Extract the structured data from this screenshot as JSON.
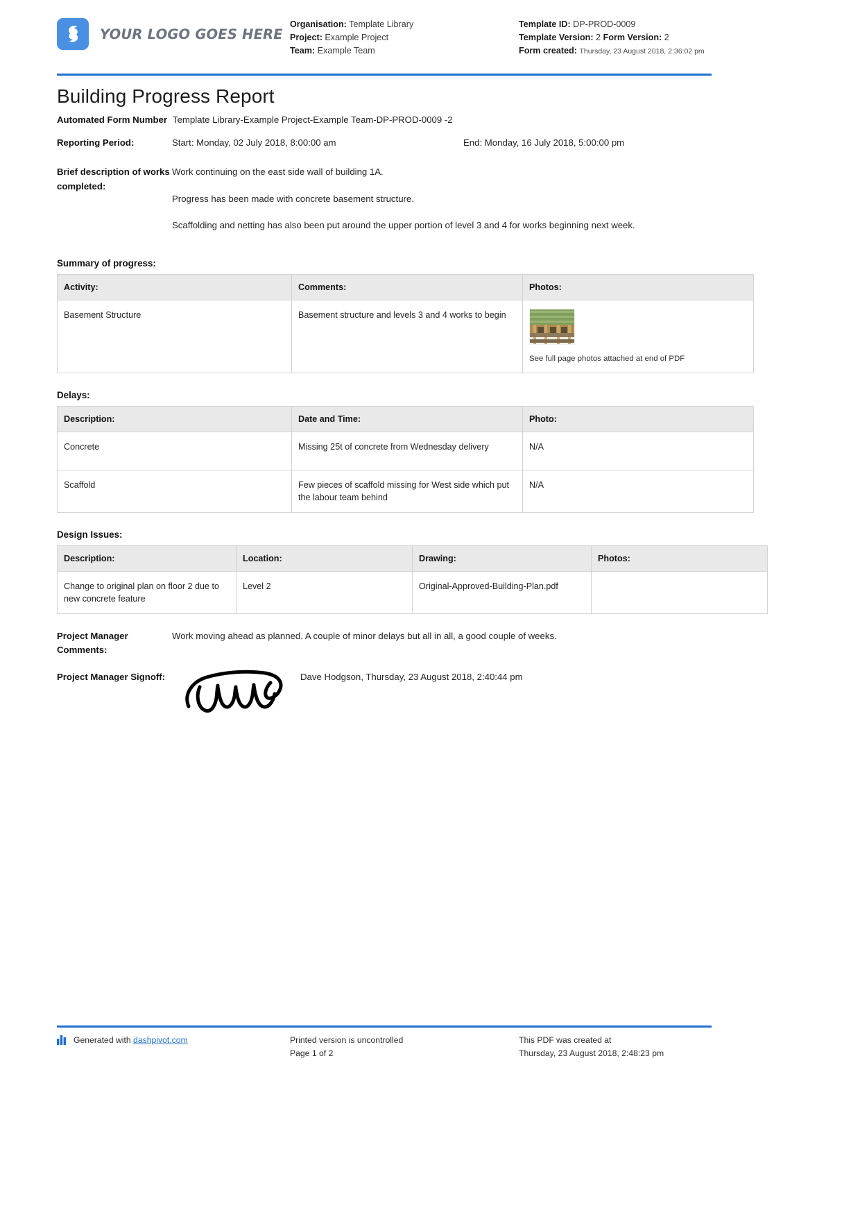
{
  "header": {
    "logo_text": "YOUR LOGO GOES HERE",
    "logo_icon": "dashpivot-logo-icon",
    "organisation_label": "Organisation:",
    "organisation_value": "Template Library",
    "project_label": "Project:",
    "project_value": "Example Project",
    "team_label": "Team:",
    "team_value": "Example Team",
    "template_id_label": "Template ID:",
    "template_id_value": "DP-PROD-0009",
    "template_version_label": "Template Version:",
    "template_version_value": "2",
    "form_version_label": "Form Version:",
    "form_version_value": "2",
    "form_created_label": "Form created:",
    "form_created_value": "Thursday, 23 August 2018, 2:36:02 pm"
  },
  "title": "Building Progress Report",
  "fields": {
    "automated_form_number_label": "Automated Form Number",
    "automated_form_number_value": "Template Library-Example Project-Example Team-DP-PROD-0009   -2",
    "reporting_period_label": "Reporting Period:",
    "reporting_period_start": "Start: Monday, 02 July 2018, 8:00:00 am",
    "reporting_period_end": "End: Monday, 16 July 2018, 5:00:00 pm",
    "brief_description_label": "Brief description of works completed:",
    "brief_description_paragraphs": [
      "Work continuing on the east side wall of building 1A.",
      "Progress has been made with concrete basement structure.",
      "Scaffolding and netting has also been put around the upper portion of level 3 and 4 for works beginning next week."
    ]
  },
  "summary_of_progress": {
    "heading": "Summary of progress:",
    "columns": [
      "Activity:",
      "Comments:",
      "Photos:"
    ],
    "rows": [
      {
        "activity": "Basement Structure",
        "comments": "Basement structure and levels 3 and 4 works to begin",
        "photo_caption": "See full page photos attached at end of PDF"
      }
    ]
  },
  "delays": {
    "heading": "Delays:",
    "columns": [
      "Description:",
      "Date and Time:",
      "Photo:"
    ],
    "rows": [
      {
        "description": "Concrete",
        "date_and_time": "Missing 25t of concrete from Wednesday delivery",
        "photo": "N/A"
      },
      {
        "description": "Scaffold",
        "date_and_time": "Few pieces of scaffold missing for West side which put the labour team behind",
        "photo": "N/A"
      }
    ]
  },
  "design_issues": {
    "heading": "Design Issues:",
    "columns": [
      "Description:",
      "Location:",
      "Drawing:",
      "Photos:"
    ],
    "rows": [
      {
        "description": "Change to original plan on floor 2 due to new concrete feature",
        "location": "Level 2",
        "drawing": "Original-Approved-Building-Plan.pdf",
        "photos": ""
      }
    ]
  },
  "project_manager": {
    "comments_label": "Project Manager Comments:",
    "comments_value": "Work moving ahead as planned. A couple of minor delays but all in all, a good couple of weeks.",
    "signoff_label": "Project Manager Signoff:",
    "signoff_value": "Dave Hodgson, Thursday, 23 August 2018, 2:40:44 pm"
  },
  "footer": {
    "generated_with": "Generated with",
    "generated_link": "dashpivot.com",
    "printed_note": "Printed version is uncontrolled",
    "page_number": "Page 1 of 2",
    "pdf_created_label": "This PDF was created at",
    "pdf_created_value": "Thursday, 23 August 2018, 2:48:23 pm"
  },
  "colors": {
    "accent_blue": "#1f6fd0",
    "logo_blue": "#4a90e2",
    "table_header_gray": "#e9e9e9",
    "border_gray": "#d2d2d2"
  }
}
